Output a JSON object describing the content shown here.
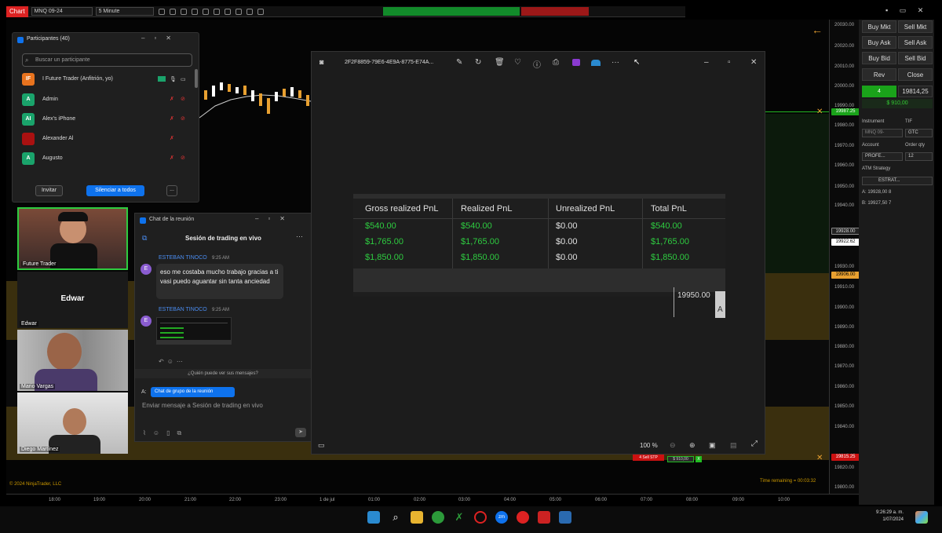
{
  "topbar": {
    "chart_label": "Chart",
    "instrument": "MNQ 09-24",
    "timeframe": "5 Minute",
    "green_banner": "",
    "red_banner": ""
  },
  "window_controls": "▪ ▭ ✕",
  "price_axis": {
    "labels": [
      "20030.00",
      "20020.00",
      "20010.00",
      "20000.00",
      "19990.00",
      "19980.00",
      "19970.00",
      "19960.00",
      "19950.00",
      "19940.00",
      "19930.00",
      "19910.00",
      "19900.00",
      "19890.00",
      "19880.00",
      "19870.00",
      "19860.00",
      "19850.00",
      "19840.00",
      "19830.00",
      "19820.00",
      "19810.00",
      "19800.00"
    ],
    "tag_green": "19987.25",
    "tag_dark": "19928.00",
    "tag_white": "19922.62",
    "tag_orange": "19906.00",
    "tag_red": "19815.25"
  },
  "time_axis": [
    "18:00",
    "19:00",
    "20:00",
    "21:00",
    "22:00",
    "23:00",
    "1 de jul",
    "01:00",
    "02:00",
    "03:00",
    "04:00",
    "05:00",
    "06:00",
    "07:00",
    "08:00",
    "09:00",
    "10:00"
  ],
  "copyright": "© 2024 NinjaTrader, LLC",
  "time_remaining": "Time remaining = 00:03:32",
  "sell_stp": {
    "label": "4 Sell STP",
    "value": "$ 910,00",
    "x": "X"
  },
  "right_panel": {
    "buy_mkt": "Buy Mkt",
    "sell_mkt": "Sell Mkt",
    "buy_ask": "Buy Ask",
    "sell_ask": "Sell Ask",
    "buy_bid": "Buy Bid",
    "sell_bid": "Sell Bid",
    "rev": "Rev",
    "close": "Close",
    "position_qty": "4",
    "position_price": "19814,25",
    "position_pnl": "$ 910,00",
    "instrument_label": "Instrument",
    "tif_label": "TIF",
    "instrument_value": "MNQ 09-",
    "tif_value": "GTC",
    "account_label": "Account",
    "order_qty_label": "Order qty",
    "account_value": "PROFE...",
    "order_qty_value": "12",
    "atm_label": "ATM Strategy",
    "atm_value": "ESTRAT...",
    "a_line": "A:  19928,00     8",
    "b_line": "B:  19927,50     7"
  },
  "participants": {
    "title": "Participantes (40)",
    "search_placeholder": "Buscar un participante",
    "list": [
      {
        "initials": "IF",
        "name": "I Future Trader (Anfitrión, yo)",
        "color": "#e8731e"
      },
      {
        "initials": "A",
        "name": "Admin",
        "color": "#1aa36b"
      },
      {
        "initials": "AI",
        "name": "Alex's iPhone",
        "color": "#1aa36b"
      },
      {
        "initials": "",
        "name": "Alexander Al",
        "color": "#a11"
      },
      {
        "initials": "A",
        "name": "Augusto",
        "color": "#1aa36b"
      }
    ],
    "invite": "Invitar",
    "mute_all": "Silenciar a todos",
    "more": "..."
  },
  "video_tiles": {
    "t1": "Future Trader",
    "t2_name": "Edwar",
    "t2_label": "Edwar",
    "t3": "Mario Vargas",
    "t4": "Diego Martínez"
  },
  "chat": {
    "window_title": "Chat de la reunión",
    "header": "Sesión de trading en vivo",
    "sender1": "ESTEBAN TINOCO",
    "time1": "9:25 AM",
    "msg1": "eso me costaba mucho trabajo gracias a ti vasi puedo aguantar sin tanta anciedad",
    "sender2": "ESTEBAN TINOCO",
    "time2": "9:25 AM",
    "who_sees": "¿Quién puede ver sus mensajes?",
    "to_label": "A:",
    "to_value": "Chat de grupo de la reunión",
    "input_placeholder": "Enviar mensaje a Sesión de trading en vivo"
  },
  "viewer": {
    "title": "2F2F8859-79E6-4E9A-8775-E74A...",
    "headers": [
      "Gross realized PnL",
      "Realized PnL",
      "Unrealized PnL",
      "Total PnL"
    ],
    "rows": [
      [
        "$540.00",
        "$540.00",
        "$0.00",
        "$540.00"
      ],
      [
        "$1,765.00",
        "$1,765.00",
        "$0.00",
        "$1,765.00"
      ],
      [
        "$1,850.00",
        "$1,850.00",
        "$0.00",
        "$1,850.00"
      ]
    ],
    "partial_price": "19950.00",
    "partial_letter": "A",
    "zoom": "100 %"
  },
  "clock": {
    "time": "9:26:29 a. m.",
    "date": "1/07/2024"
  },
  "colors": {
    "profit_green": "#2ecc40",
    "accent_blue": "#0e72ed",
    "band": "#3a2f0e"
  }
}
